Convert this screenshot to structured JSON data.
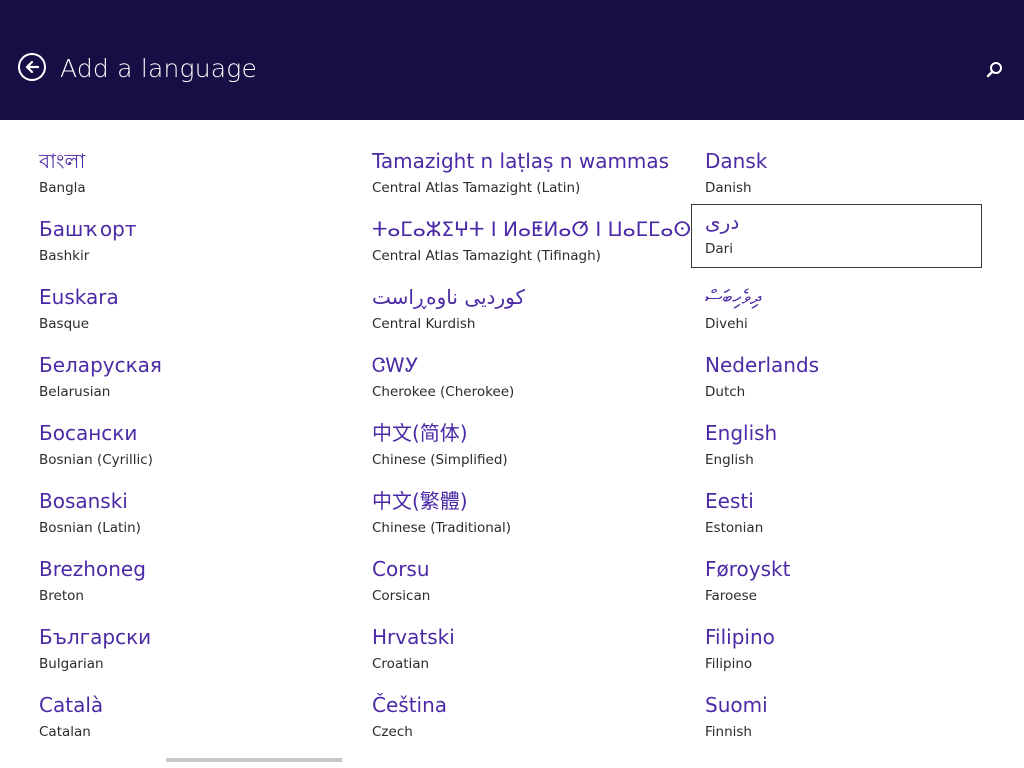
{
  "header": {
    "title": "Add a language",
    "back_icon": "back-arrow-circle-icon",
    "search_icon": "search-icon",
    "background": "#180d45"
  },
  "languages": [
    [
      {
        "native": "বাংলা",
        "english": "Bangla"
      },
      {
        "native": "Башҡорт",
        "english": "Bashkir"
      },
      {
        "native": "Euskara",
        "english": "Basque"
      },
      {
        "native": "Беларуская",
        "english": "Belarusian"
      },
      {
        "native": "Босански",
        "english": "Bosnian (Cyrillic)"
      },
      {
        "native": "Bosanski",
        "english": "Bosnian (Latin)"
      },
      {
        "native": "Brezhoneg",
        "english": "Breton"
      },
      {
        "native": "Български",
        "english": "Bulgarian"
      },
      {
        "native": "Català",
        "english": "Catalan"
      }
    ],
    [
      {
        "native": "Tamazight n laṭlaṣ n wammas",
        "english": "Central Atlas Tamazight (Latin)"
      },
      {
        "native": "ⵜⴰⵎⴰⵣⵉⵖⵜ ⵏ ⵍⴰⵟⵍⴰⵚ ⵏ ⵡⴰⵎⵎⴰⵙ",
        "english": "Central Atlas Tamazight (Tifinagh)"
      },
      {
        "native": "کوردیی ناوەڕاست",
        "english": "Central Kurdish"
      },
      {
        "native": "ᏣᎳᎩ",
        "english": "Cherokee (Cherokee)"
      },
      {
        "native": "中文(简体)",
        "english": "Chinese (Simplified)"
      },
      {
        "native": "中文(繁體)",
        "english": "Chinese (Traditional)"
      },
      {
        "native": "Corsu",
        "english": "Corsican"
      },
      {
        "native": "Hrvatski",
        "english": "Croatian"
      },
      {
        "native": "Čeština",
        "english": "Czech"
      }
    ],
    [
      {
        "native": "Dansk",
        "english": "Danish"
      },
      {
        "native": "درى",
        "english": "Dari",
        "selected": true
      },
      {
        "native": "ދިވެހިބަސް",
        "english": "Divehi"
      },
      {
        "native": "Nederlands",
        "english": "Dutch"
      },
      {
        "native": "English",
        "english": "English"
      },
      {
        "native": "Eesti",
        "english": "Estonian"
      },
      {
        "native": "Føroyskt",
        "english": "Faroese"
      },
      {
        "native": "Filipino",
        "english": "Filipino"
      },
      {
        "native": "Suomi",
        "english": "Finnish"
      }
    ]
  ],
  "colors": {
    "native_text": "#4b2aa6",
    "english_text": "#2b2b2b",
    "selection_border": "#3a3a3a"
  }
}
